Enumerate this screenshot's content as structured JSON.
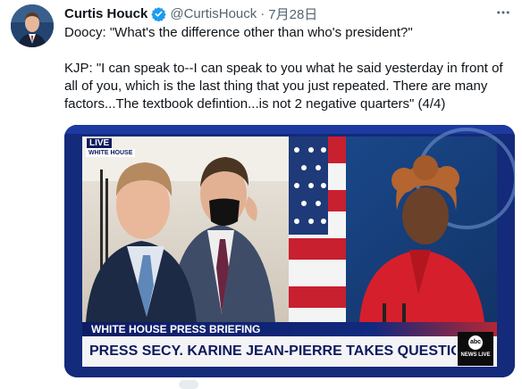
{
  "tweet": {
    "author_name": "Curtis Houck",
    "handle": "@CurtisHouck",
    "separator": "·",
    "date": "7月28日",
    "text": "Doocy: \"What's the difference other than who's president?\"\n\nKJP: \"I can speak to--I can speak to you what he said yesterday in front of all of you, which is the last thing that you just repeated. There are many factors...The textbook defintion...is not 2 negative quarters\" (4/4)"
  },
  "icons": {
    "verified": "verified-badge-icon",
    "more": "more-options-icon"
  },
  "video": {
    "live_label": "LIVE",
    "location_label": "WHITE HOUSE",
    "banner_top": "WHITE HOUSE PRESS BRIEFING",
    "banner_main": "PRESS SECY. KARINE JEAN-PIERRE TAKES QUESTIONS",
    "network_logo": "abc",
    "network_sub": "NEWS LIVE"
  },
  "colors": {
    "verified_blue": "#1d9bf0",
    "text_primary": "#0f1419",
    "text_secondary": "#536471",
    "banner_navy": "#0d1b5c",
    "banner_red": "#b0212b",
    "jacket_red": "#d61f2c"
  }
}
